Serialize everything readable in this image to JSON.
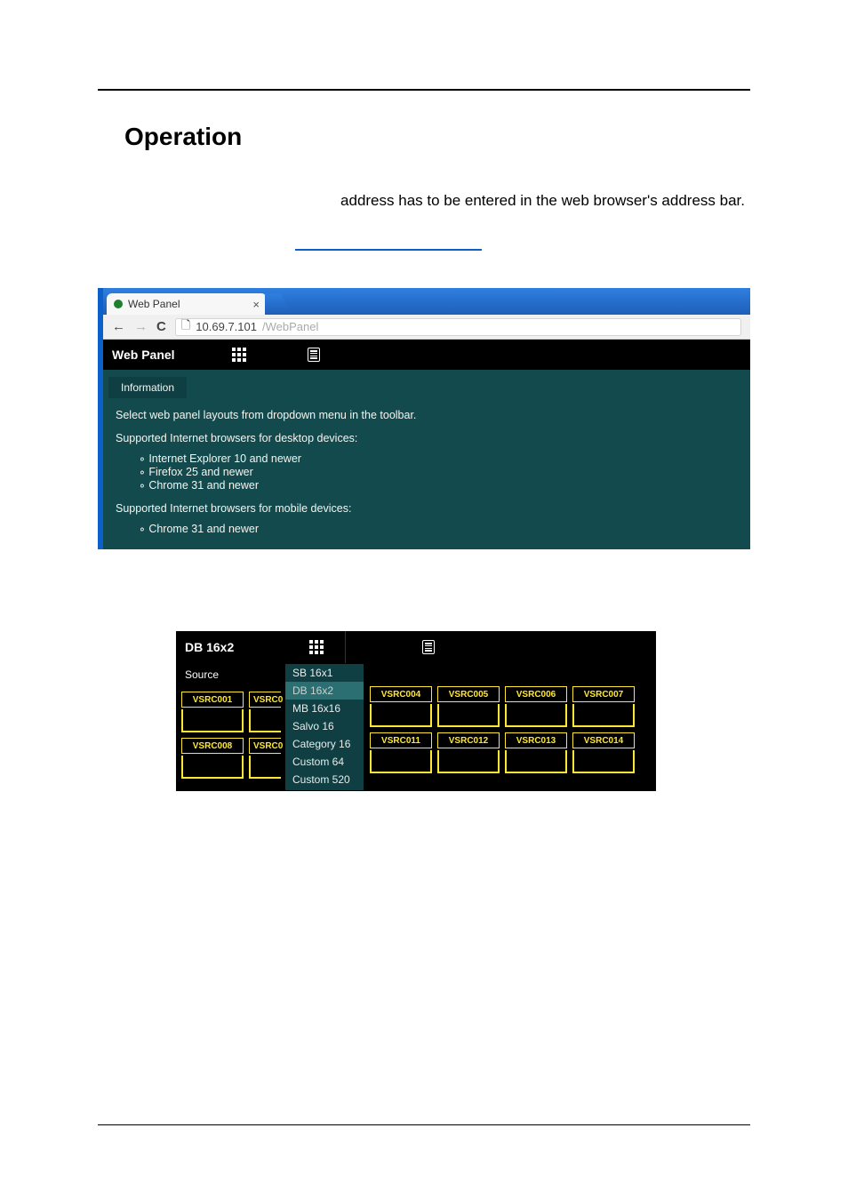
{
  "heading": "Operation",
  "intro_fragment": "address has to be entered in the web browser's address bar.",
  "browser_tab": {
    "title": "Web Panel",
    "close_glyph": "×"
  },
  "address_bar": {
    "back_glyph": "←",
    "forward_glyph": "→",
    "reload_glyph": "C",
    "page_glyph": "🗋",
    "url_host": "10.69.7.101",
    "url_path": "/WebPanel"
  },
  "panel": {
    "title": "Web Panel",
    "info_label": "Information",
    "line1": "Select web panel layouts from dropdown menu in the toolbar.",
    "line2": "Supported Internet browsers for desktop devices:",
    "desktop_list": [
      "Internet Explorer 10 and newer",
      "Firefox 25 and newer",
      "Chrome 31 and newer"
    ],
    "line3": "Supported Internet browsers for mobile devices:",
    "mobile_list": [
      "Chrome 31 and newer"
    ]
  },
  "shot2": {
    "title": "DB 16x2",
    "source_label": "Source",
    "dropdown": [
      "SB 16x1",
      "DB 16x2",
      "MB 16x16",
      "Salvo 16",
      "Category 16",
      "Custom 64",
      "Custom 520"
    ],
    "left_buttons_row1": [
      "VSRC001"
    ],
    "left_buttons_row2": [
      "VSRC008"
    ],
    "stub_label": "VSRC0",
    "grid_row1": [
      "VSRC004",
      "VSRC005",
      "VSRC006",
      "VSRC007"
    ],
    "grid_row2": [
      "VSRC011",
      "VSRC012",
      "VSRC013",
      "VSRC014"
    ]
  }
}
